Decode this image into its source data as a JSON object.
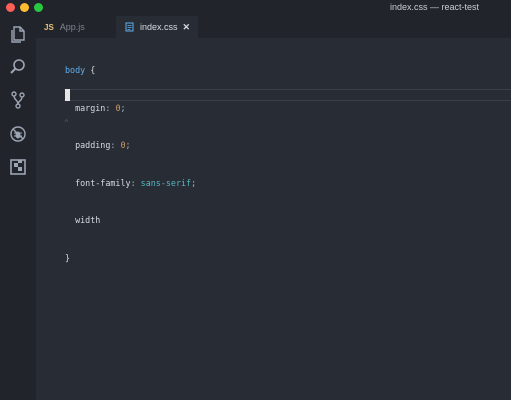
{
  "window": {
    "title": "index.css — react-test"
  },
  "activity_bar": {
    "items": [
      {
        "name": "explorer",
        "icon": "files-icon"
      },
      {
        "name": "search",
        "icon": "search-icon"
      },
      {
        "name": "source-control",
        "icon": "source-control-icon"
      },
      {
        "name": "debug",
        "icon": "debug-icon"
      },
      {
        "name": "extensions",
        "icon": "extensions-icon"
      }
    ]
  },
  "tabs": [
    {
      "badge": "JS",
      "label": "App.js",
      "active": false
    },
    {
      "label": "index.css",
      "active": true,
      "close": "✕"
    }
  ],
  "editor": {
    "lines": [
      {
        "selector": "body",
        "brace": " {"
      },
      {
        "indent": "  ",
        "prop": "margin",
        "colon": ": ",
        "value": "0",
        "value_kind": "num",
        "semi": ";"
      },
      {
        "indent": "  ",
        "prop": "padding",
        "colon": ": ",
        "value": "0",
        "value_kind": "num",
        "semi": ";"
      },
      {
        "indent": "  ",
        "prop": "font-family",
        "colon": ": ",
        "value": "sans-serif",
        "value_kind": "val",
        "semi": ";"
      },
      {
        "indent": "  ",
        "prop": "width",
        "colon": "",
        "value": "",
        "value_kind": "",
        "semi": ""
      },
      {
        "close": "}"
      }
    ],
    "fold_marker": "⌃"
  },
  "colors": {
    "background": "#282c34",
    "chrome": "#21252b",
    "selector": "#61afef",
    "number": "#d19a66",
    "value": "#56b6c2",
    "js_badge": "#e5c07b"
  }
}
